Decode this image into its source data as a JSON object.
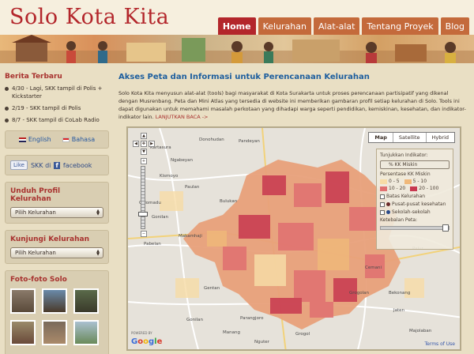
{
  "site": {
    "title": "Solo Kota Kita"
  },
  "nav": {
    "items": [
      "Home",
      "Kelurahan",
      "Alat-alat",
      "Tentang Proyek",
      "Blog"
    ]
  },
  "sidebar": {
    "news_heading": "Berita Terbaru",
    "news": [
      "4/30 - Lagi, SKK tampil di Polis + Kickstarter",
      "2/19 - SKK tampil di Polis",
      "8/7 - SKK tampil di CoLab Radio"
    ],
    "lang_en": "English",
    "lang_id": "Bahasa",
    "fb_like": "Like",
    "fb_text": "SKK di",
    "fb_brand": "facebook",
    "profil_heading": "Unduh Profil Kelurahan",
    "profil_select": "Pilih Kelurahan",
    "kunjungi_heading": "Kunjungi Kelurahan",
    "kunjungi_select": "Pilih Kelurahan",
    "photos_heading": "Foto-foto Solo"
  },
  "main": {
    "title": "Akses Peta dan Informasi untuk Perencanaan Kelurahan",
    "intro": "Solo Kota Kita menyusun alat-alat (tools) bagi masyarakat di Kota Surakarta untuk proses perencanaan partisipatif yang dikenal dengan Musrenbang. Peta dan Mini Atlas yang tersedia di website ini memberikan gambaran profil setiap kelurahan di Solo. Tools ini dapat digunakan untuk memahami masalah perkotaan yang dihadapi warga seperti pendidikan, kemiskinan, kesehatan, dan indikator-indikator lain.",
    "read_more": "LANJUTKAN BACA ->"
  },
  "map": {
    "types": [
      "Map",
      "Satellite",
      "Hybrid"
    ],
    "places": [
      "Donohudan",
      "Pandeyan",
      "Ngabeyan",
      "Kismoyo",
      "Paulan",
      "Bulukan",
      "Gonilan",
      "Colomadu",
      "Pabelan",
      "Makamhaji",
      "Gentan",
      "Gonilan",
      "Cemani",
      "Grogolan",
      "Bekonang",
      "Parangjoro",
      "Manang",
      "Nguter",
      "Jaten",
      "Palur",
      "Grogol",
      "Majolaban",
      "Kartasura"
    ],
    "legend": {
      "indicator_label": "Tunjukkan Indikator:",
      "indicator_value": "% KK Miskin",
      "percent_label": "Persentase KK Miskin",
      "ranges": [
        "0 - 5",
        "5 - 10",
        "10 - 20",
        "20 - 100"
      ],
      "range_colors": [
        "#f7dca6",
        "#f0b87a",
        "#e07070",
        "#c83850"
      ],
      "boundary_label": "Batas Kelurahan",
      "health_label": "Pusat-pusat kesehatan",
      "school_label": "Sekolah-sekolah",
      "opacity_label": "Ketebalan Peta:"
    },
    "google": "Google",
    "powered": "POWERED BY",
    "terms": "Terms of Use"
  }
}
